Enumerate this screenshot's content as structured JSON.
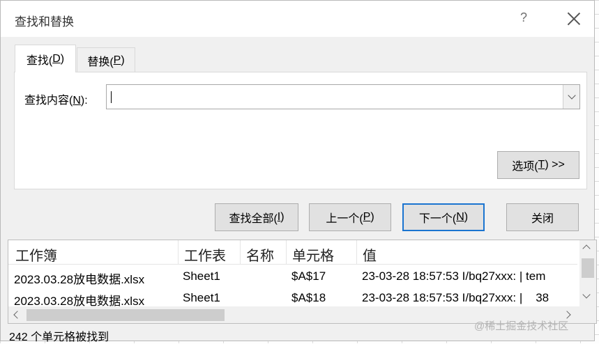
{
  "window": {
    "title": "查找和替换",
    "help_label": "?"
  },
  "tabs": [
    {
      "label": "查找(",
      "accel": "D",
      "suffix": ")",
      "active": true
    },
    {
      "label": "替换(",
      "accel": "P",
      "suffix": ")",
      "active": false
    }
  ],
  "find": {
    "label": "查找内容(",
    "accel": "N",
    "suffix": "):",
    "value": ""
  },
  "options_button": {
    "label": "选项(",
    "accel": "T",
    "suffix": ") >>"
  },
  "actions": {
    "find_all": {
      "label": "查找全部(",
      "accel": "I",
      "suffix": ")"
    },
    "prev": {
      "label": "上一个(",
      "accel": "P",
      "suffix": ")"
    },
    "next": {
      "label": "下一个(",
      "accel": "N",
      "suffix": ")"
    },
    "close": {
      "label": "关闭"
    }
  },
  "results": {
    "columns": [
      "工作簿",
      "工作表",
      "名称",
      "单元格",
      "值"
    ],
    "rows": [
      {
        "workbook": "2023.03.28放电数据.xlsx",
        "sheet": "Sheet1",
        "name": "",
        "cell": "$A$17",
        "value": "23-03-28 18:57:53 I/bq27xxx: | tem"
      },
      {
        "workbook": "2023.03.28放电数据.xlsx",
        "sheet": "Sheet1",
        "name": "",
        "cell": "$A$18",
        "value": "23-03-28 18:57:53 I/bq27xxx: |    38"
      }
    ]
  },
  "status": "242 个单元格被找到",
  "watermark": "@稀土掘金技术社区",
  "colors": {
    "dialog_bg": "#f0f0f0",
    "default_button_border": "#1a74d0"
  }
}
